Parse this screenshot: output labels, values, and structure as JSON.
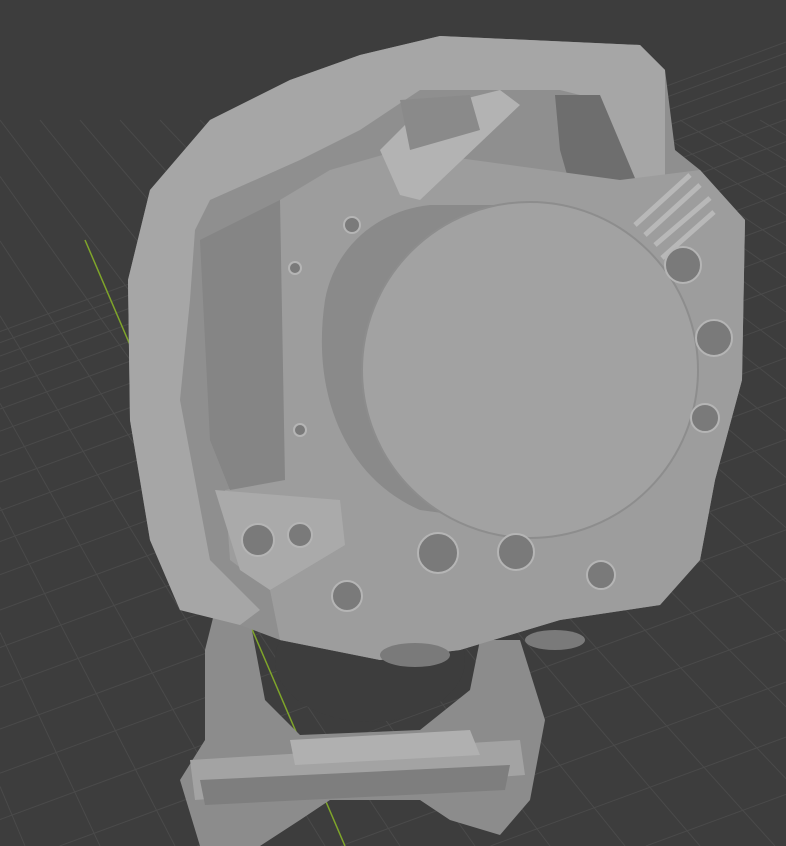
{
  "viewport": {
    "background_color": "#3d3d3d",
    "grid_color": "#4a4a4a",
    "y_axis_color": "#7fa52a",
    "model_color": "#9a9a9a"
  }
}
